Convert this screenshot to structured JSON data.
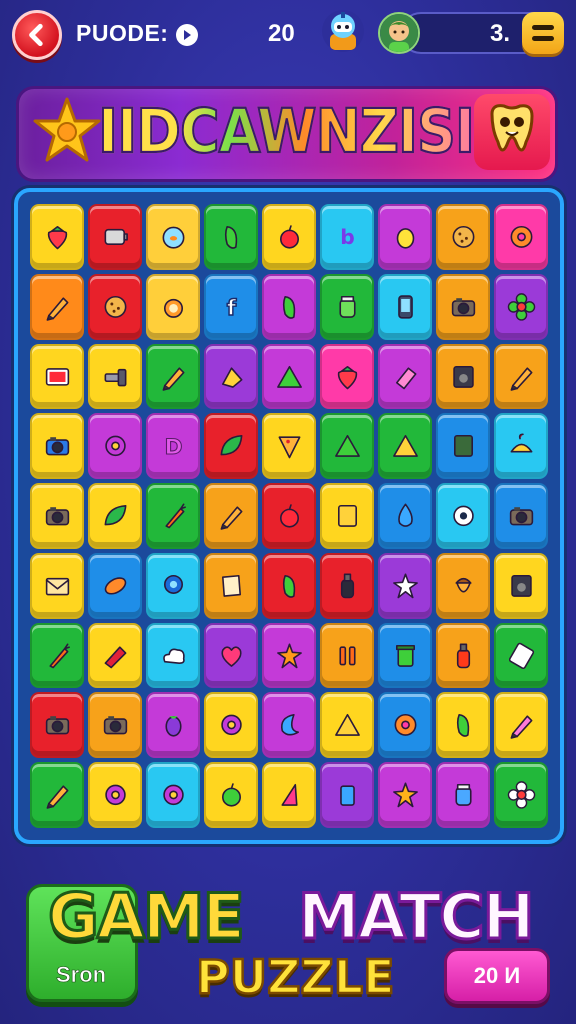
{
  "header": {
    "back_icon": "chevron-left-icon",
    "mode_label": "PUODE:",
    "info_icon": "play-circle-icon",
    "moves_value": "20",
    "score_value": "3.",
    "menu_icon": "menu-icon"
  },
  "banner": {
    "title": "IIDCAWNZISI",
    "left_icon": "star-face-icon",
    "right_icon": "tooth-face-icon"
  },
  "board": {
    "rows": 9,
    "cols": 9,
    "tiles": [
      [
        "#ffd61f",
        "strawberry"
      ],
      [
        "#e8212b",
        "battery"
      ],
      [
        "#ffcf3a",
        "fish-bowl"
      ],
      [
        "#22b83a",
        "pickle"
      ],
      [
        "#ffd61f",
        "apple"
      ],
      [
        "#29c8f2",
        "letter-b"
      ],
      [
        "#c43ad8",
        "lemon"
      ],
      [
        "#f7a21a",
        "cookie"
      ],
      [
        "#ff3aa8",
        "donut"
      ],
      [
        "#ff8a1a",
        "pencil-line"
      ],
      [
        "#e8212b",
        "cookie"
      ],
      [
        "#ffcf3a",
        "orange-slice"
      ],
      [
        "#1f8ee8",
        "letter-f"
      ],
      [
        "#c43ad8",
        "pepper"
      ],
      [
        "#22b83a",
        "jar"
      ],
      [
        "#29c8f2",
        "phone"
      ],
      [
        "#f7a21a",
        "camera"
      ],
      [
        "#9b3ad8",
        "flower"
      ],
      [
        "#ffd61f",
        "tv"
      ],
      [
        "#ffd61f",
        "tool"
      ],
      [
        "#22b83a",
        "pencil"
      ],
      [
        "#9b3ad8",
        "cheese"
      ],
      [
        "#c43ad8",
        "triangle"
      ],
      [
        "#ff3aa8",
        "strawberry"
      ],
      [
        "#c43ad8",
        "eraser"
      ],
      [
        "#f7a21a",
        "speaker"
      ],
      [
        "#f7a21a",
        "pencil"
      ],
      [
        "#ffd61f",
        "camera-blue"
      ],
      [
        "#c43ad8",
        "ring"
      ],
      [
        "#c43ad8",
        "letter-d"
      ],
      [
        "#e8212b",
        "leaf"
      ],
      [
        "#ffd61f",
        "pizza"
      ],
      [
        "#22b83a",
        "triangle"
      ],
      [
        "#22b83a",
        "triangle-gold"
      ],
      [
        "#1f8ee8",
        "box"
      ],
      [
        "#29c8f2",
        "cake"
      ],
      [
        "#ffd61f",
        "camera"
      ],
      [
        "#ffd61f",
        "leaf"
      ],
      [
        "#22b83a",
        "carrot"
      ],
      [
        "#f7a21a",
        "pencil"
      ],
      [
        "#e8212b",
        "apple"
      ],
      [
        "#ffd61f",
        "note"
      ],
      [
        "#1f8ee8",
        "drop"
      ],
      [
        "#29c8f2",
        "eye"
      ],
      [
        "#1f8ee8",
        "camera"
      ],
      [
        "#ffd61f",
        "envelope"
      ],
      [
        "#1f8ee8",
        "bread"
      ],
      [
        "#29c8f2",
        "webcam"
      ],
      [
        "#f7a21a",
        "paper"
      ],
      [
        "#e8212b",
        "pepper"
      ],
      [
        "#e8212b",
        "bottle"
      ],
      [
        "#9b3ad8",
        "star-burst"
      ],
      [
        "#f7a21a",
        "acorn"
      ],
      [
        "#ffd61f",
        "radio"
      ],
      [
        "#22b83a",
        "carrot"
      ],
      [
        "#ffd61f",
        "marker"
      ],
      [
        "#29c8f2",
        "cloud"
      ],
      [
        "#9b3ad8",
        "heart"
      ],
      [
        "#c43ad8",
        "burst"
      ],
      [
        "#f7a21a",
        "pause"
      ],
      [
        "#1f8ee8",
        "trash"
      ],
      [
        "#f7a21a",
        "bottle-red"
      ],
      [
        "#22b83a",
        "note-lines"
      ],
      [
        "#e8212b",
        "camera"
      ],
      [
        "#f7a21a",
        "camera"
      ],
      [
        "#c43ad8",
        "eggplant"
      ],
      [
        "#ffd61f",
        "ring"
      ],
      [
        "#c43ad8",
        "moon"
      ],
      [
        "#ffd61f",
        "triangle-gold"
      ],
      [
        "#1f8ee8",
        "donut"
      ],
      [
        "#ffd61f",
        "pepper"
      ],
      [
        "#ffd61f",
        "pencil-pink"
      ],
      [
        "#22b83a",
        "pencil"
      ],
      [
        "#ffd61f",
        "ring"
      ],
      [
        "#29c8f2",
        "ring"
      ],
      [
        "#ffd61f",
        "apple-green"
      ],
      [
        "#ffd61f",
        "sail"
      ],
      [
        "#9b3ad8",
        "cup"
      ],
      [
        "#c43ad8",
        "star"
      ],
      [
        "#c43ad8",
        "jar-blue"
      ],
      [
        "#22b83a",
        "flower-white"
      ]
    ]
  },
  "footer": {
    "start_label": "Sron",
    "title_game": "GAME",
    "title_match": "MATCH",
    "title_puzzle": "PUZZLE",
    "timer_label": "20 И"
  }
}
